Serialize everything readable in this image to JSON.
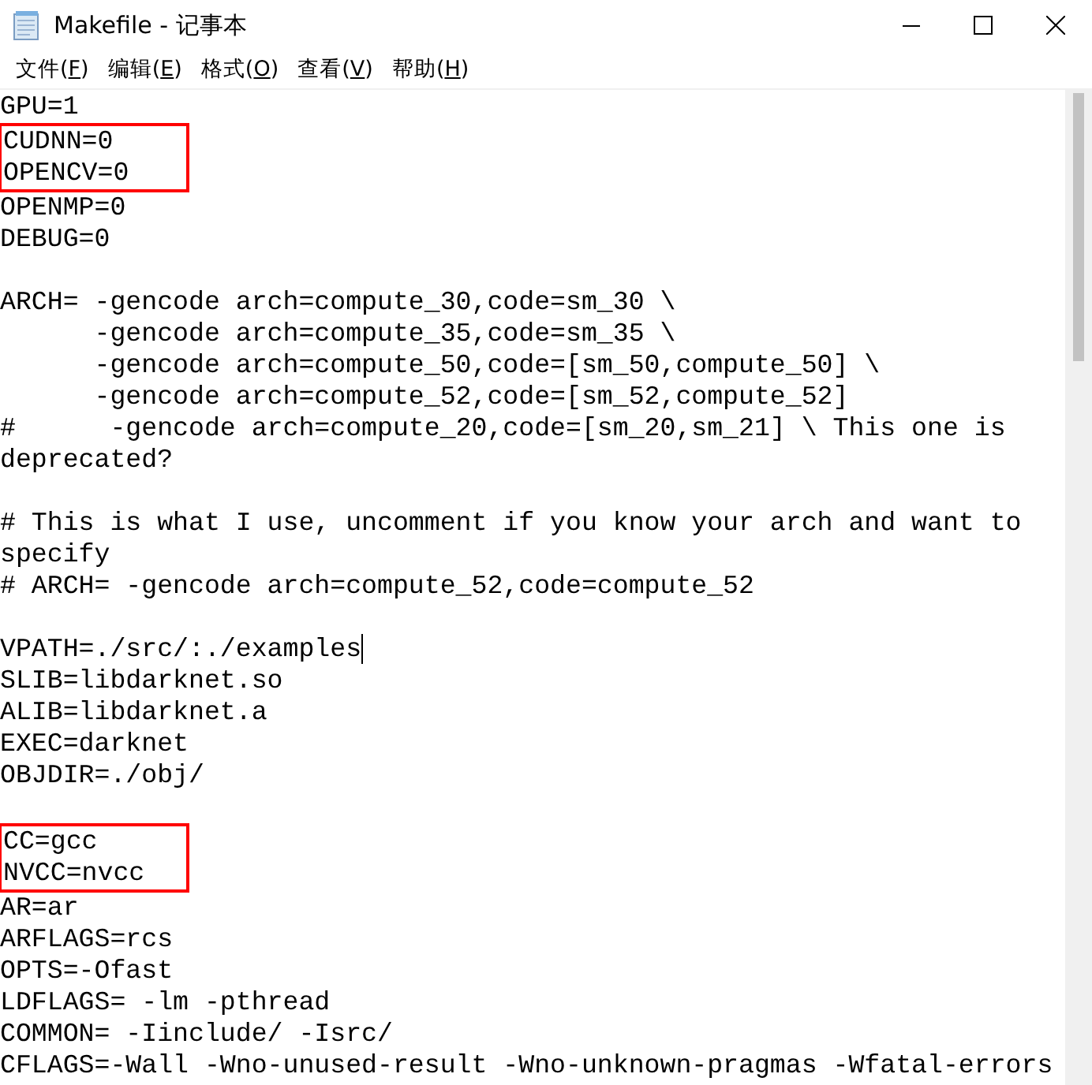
{
  "window": {
    "title": "Makefile - 记事本"
  },
  "menu": [
    {
      "label": "文件(F)"
    },
    {
      "label": "编辑(E)"
    },
    {
      "label": "格式(O)"
    },
    {
      "label": "查看(V)"
    },
    {
      "label": "帮助(H)"
    }
  ],
  "editor": {
    "blocks": [
      [
        {
          "text": "GPU=1",
          "highlighted": false
        },
        {
          "text": "CUDNN=0",
          "highlighted": true
        },
        {
          "text": "OPENCV=0",
          "highlighted": true
        },
        {
          "text": "OPENMP=0",
          "highlighted": false
        },
        {
          "text": "DEBUG=0",
          "highlighted": false
        }
      ],
      [
        {
          "text": "ARCH= -gencode arch=compute_30,code=sm_30 \\",
          "highlighted": false
        },
        {
          "text": "      -gencode arch=compute_35,code=sm_35 \\",
          "highlighted": false
        },
        {
          "text": "      -gencode arch=compute_50,code=[sm_50,compute_50] \\",
          "highlighted": false
        },
        {
          "text": "      -gencode arch=compute_52,code=[sm_52,compute_52]",
          "highlighted": false
        },
        {
          "text": "#      -gencode arch=compute_20,code=[sm_20,sm_21] \\ This one is",
          "highlighted": false
        },
        {
          "text": "deprecated?",
          "highlighted": false
        }
      ],
      [
        {
          "text": "# This is what I use, uncomment if you know your arch and want to",
          "highlighted": false
        },
        {
          "text": "specify",
          "highlighted": false
        },
        {
          "text": "# ARCH= -gencode arch=compute_52,code=compute_52",
          "highlighted": false
        }
      ],
      [
        {
          "text": "VPATH=./src/:./examples",
          "highlighted": false,
          "caret": true
        },
        {
          "text": "SLIB=libdarknet.so",
          "highlighted": false
        },
        {
          "text": "ALIB=libdarknet.a",
          "highlighted": false
        },
        {
          "text": "EXEC=darknet",
          "highlighted": false
        },
        {
          "text": "OBJDIR=./obj/",
          "highlighted": false
        }
      ],
      [
        {
          "text": "CC=gcc",
          "highlighted": true
        },
        {
          "text": "NVCC=nvcc",
          "highlighted": true
        },
        {
          "text": "AR=ar",
          "highlighted": false
        },
        {
          "text": "ARFLAGS=rcs",
          "highlighted": false
        },
        {
          "text": "OPTS=-Ofast",
          "highlighted": false
        },
        {
          "text": "LDFLAGS= -lm -pthread",
          "highlighted": false
        },
        {
          "text": "COMMON= -Iinclude/ -Isrc/",
          "highlighted": false
        },
        {
          "text": "CFLAGS=-Wall -Wno-unused-result -Wno-unknown-pragmas -Wfatal-errors",
          "highlighted": false
        }
      ]
    ]
  }
}
